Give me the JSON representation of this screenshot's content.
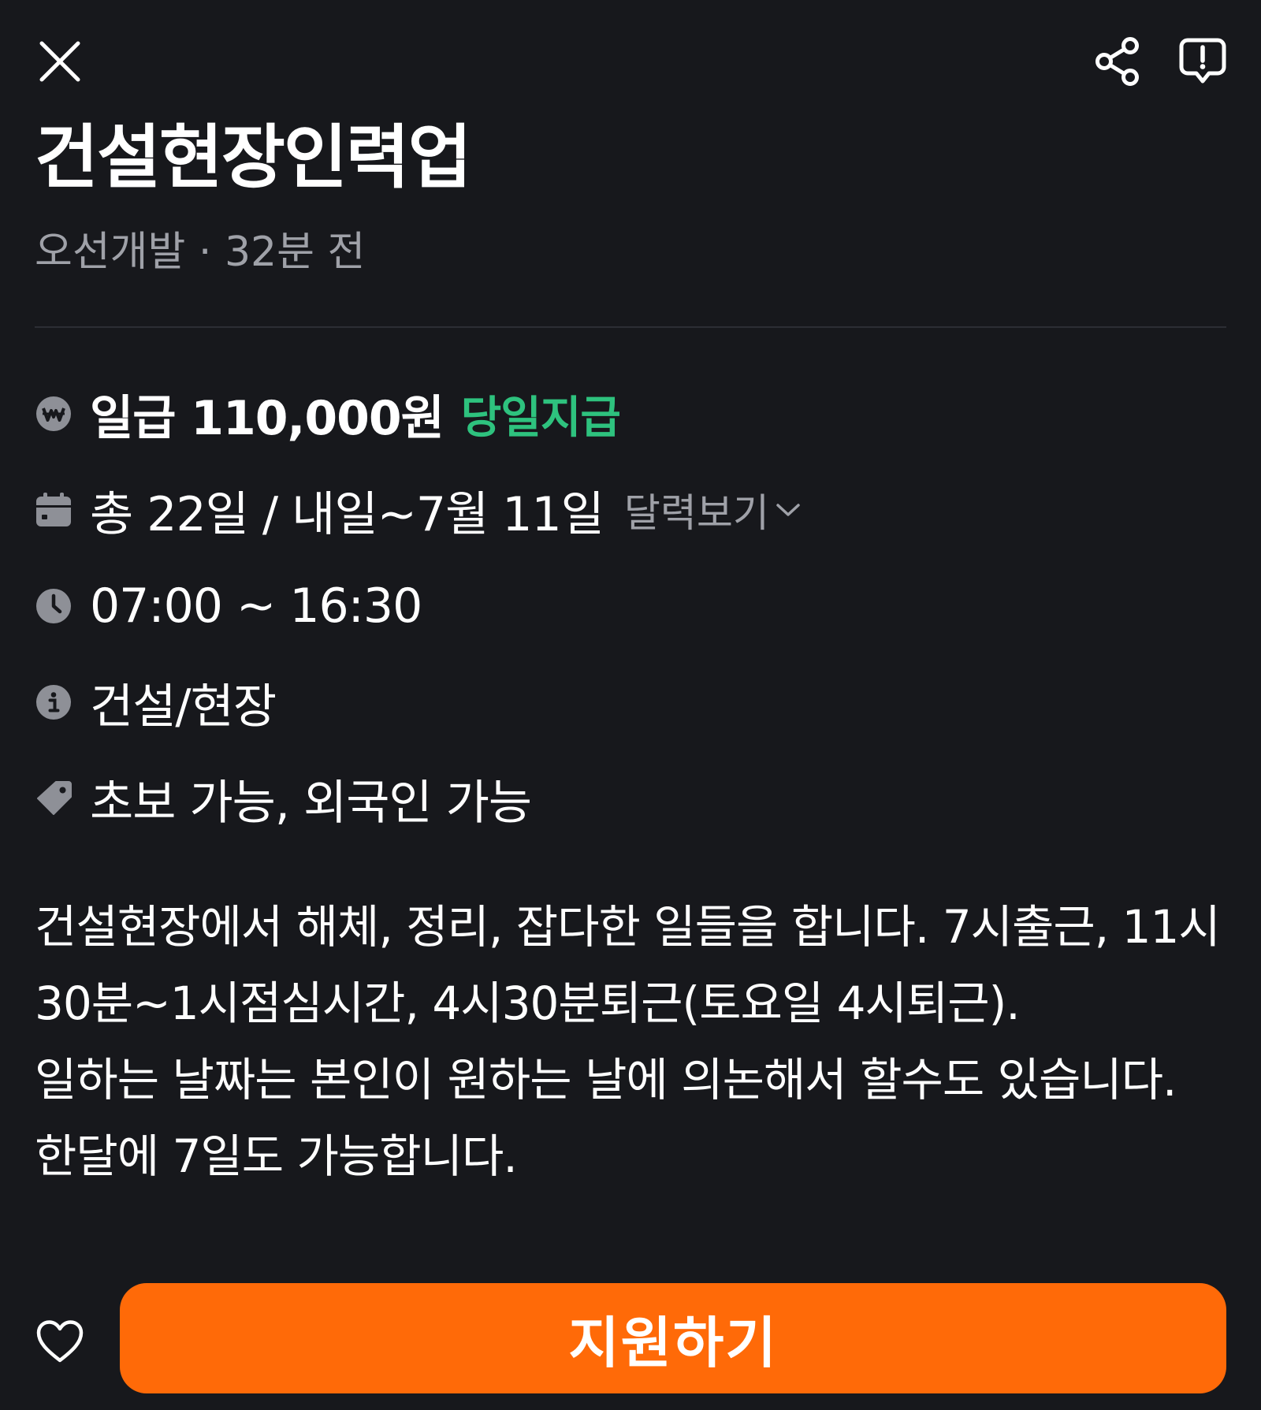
{
  "header": {
    "close_icon": "close-icon",
    "share_icon": "share-icon",
    "report_icon": "report-icon"
  },
  "job": {
    "title": "건설현장인력업",
    "meta": "오선개발 · 32분 전"
  },
  "info": {
    "wage": {
      "icon": "won-icon",
      "text": "일급 110,000원",
      "badge": "당일지급"
    },
    "period": {
      "icon": "calendar-icon",
      "text": "총 22일 / 내일~7월 11일",
      "link": "달력보기"
    },
    "time": {
      "icon": "clock-icon",
      "text": "07:00 ~ 16:30"
    },
    "category": {
      "icon": "info-icon",
      "text": "건설/현장"
    },
    "tags": {
      "icon": "tag-icon",
      "text": "초보 가능, 외국인 가능"
    }
  },
  "description": {
    "line1": "건설현장에서 해체, 정리, 잡다한 일들을 합니다. 7시출근, 11시30분~1시점심시간, 4시30분퇴근(토요일 4시퇴근).",
    "line2": "일하는 날짜는 본인이 원하는 날에 의논해서 할수도 있습니다.",
    "line3": "한달에 7일도 가능합니다."
  },
  "footer": {
    "heart_icon": "heart-icon",
    "apply_label": "지원하기"
  },
  "colors": {
    "background": "#17181c",
    "accent": "#ff6a08",
    "green": "#2ec27e",
    "muted": "#9fa1a8"
  }
}
